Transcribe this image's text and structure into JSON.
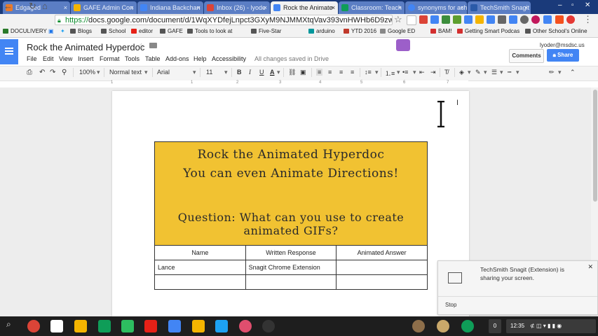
{
  "browser": {
    "tabs": [
      {
        "label": "Edgaged",
        "color": "#e97a2a"
      },
      {
        "label": "GAFE Admin Con",
        "color": "#f4b400"
      },
      {
        "label": "Indiana Backchan",
        "color": "#4285f4"
      },
      {
        "label": "Inbox (26) - lyode",
        "color": "#db4437"
      },
      {
        "label": "Rock the Animate",
        "color": "#4285f4"
      },
      {
        "label": "Classroom: Teach",
        "color": "#0f9d58"
      },
      {
        "label": "synonyms for ach",
        "color": "#4285f4"
      },
      {
        "label": "TechSmith Snagit",
        "color": "#2a5aa8"
      }
    ],
    "url_scheme": "https://",
    "url_rest": "docs.google.com/document/d/1WqXYDfejLnpct3GXyM9NJMMXtqVav393vnHWHb6D9zw/edit",
    "bookmarks": [
      "DOCULIVERY",
      "Blogs",
      "School",
      "editor",
      "GAFE",
      "Tools to look at",
      "Five-Star",
      "arduino",
      "YTD 2016",
      "Google ED",
      "BAM!",
      "Getting Smart Podcas",
      "Other School's Online"
    ]
  },
  "docs": {
    "title": "Rock the Animated Hyperdoc",
    "menu": [
      "File",
      "Edit",
      "View",
      "Insert",
      "Format",
      "Tools",
      "Table",
      "Add-ons",
      "Help",
      "Accessibility"
    ],
    "save_status": "All changes saved in Drive",
    "user_email": "lyoder@msdsc.us",
    "comments_label": "Comments",
    "share_label": "Share",
    "toolbar": {
      "zoom": "100%",
      "style": "Normal text",
      "font": "Arial",
      "size": "11",
      "bold": "B",
      "italic": "I",
      "underline": "U",
      "text_color": "A"
    },
    "ruler_numbers": [
      "1",
      "1",
      "2",
      "3",
      "4",
      "5",
      "6",
      "7"
    ]
  },
  "document": {
    "banner_line1": "Rock the Animated Hyperdoc",
    "banner_line2": "You can even Animate Directions!",
    "banner_line3": "Question: What can you use to create animated GIFs?",
    "banner_color": "#f1c232",
    "table_headers": [
      "Name",
      "Written Response",
      "Animated Answer"
    ],
    "table_rows": [
      [
        "Lance",
        "Snagit Chrome Extension",
        ""
      ],
      [
        "",
        "",
        ""
      ]
    ]
  },
  "snagit_notice": {
    "message": "TechSmith Snagit (Extension) is sharing your screen.",
    "stop_label": "Stop"
  },
  "taskbar": {
    "time": "12:35",
    "notification_count": "0"
  }
}
